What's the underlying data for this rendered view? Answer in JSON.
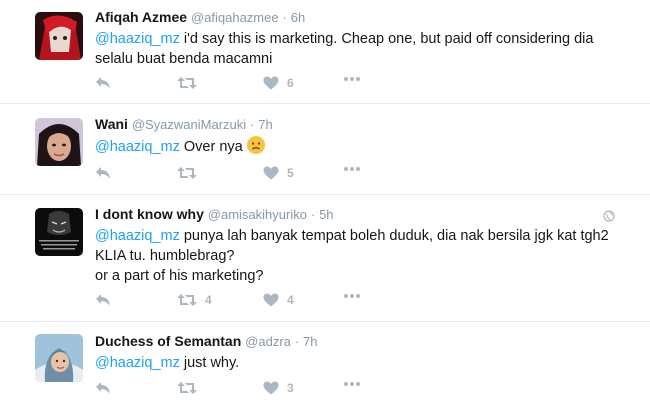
{
  "tweets": [
    {
      "name": "Afiqah Azmee",
      "handle": "@afiqahazmee",
      "dot": "·",
      "time": "6h",
      "mention": "@haaziq_mz",
      "text": " i'd say this is marketing. Cheap one, but paid off considering dia selalu buat benda macamni",
      "retweets": "",
      "likes": "6"
    },
    {
      "name": "Wani",
      "handle": "@SyazwaniMarzuki",
      "dot": "·",
      "time": "7h",
      "mention": "@haaziq_mz",
      "text": " Over nya",
      "emoji": "😕",
      "retweets": "",
      "likes": "5"
    },
    {
      "name": "I dont know why",
      "handle": "@amisakihyuriko",
      "dot": "·",
      "time": "5h",
      "mention": "@haaziq_mz",
      "text": " punya lah banyak tempat boleh duduk, dia nak bersila jgk kat tgh2 KLIA tu. humblebrag?",
      "text2": "or a part of his marketing?",
      "retweets": "4",
      "likes": "4"
    },
    {
      "name": "Duchess of Semantan",
      "handle": "@adzra",
      "dot": "·",
      "time": "7h",
      "mention": "@haaziq_mz",
      "text": " just why.",
      "retweets": "",
      "likes": "3"
    }
  ],
  "colors": {
    "mention": "#1da1f2",
    "meta": "#8899a6",
    "icon": "#aab8c2",
    "divider": "#e6ecf0"
  },
  "icons": [
    "reply-icon",
    "retweet-icon",
    "like-icon",
    "more-icon",
    "globe-icon"
  ]
}
